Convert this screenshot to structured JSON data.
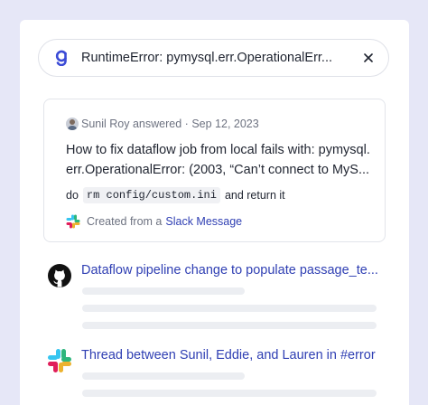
{
  "search": {
    "query": "RuntimeError: pymysql.err.OperationalErr...",
    "logo_icon": "g-logo-icon",
    "close_icon": "close-icon"
  },
  "answer_card": {
    "author": "Sunil Roy",
    "action": "answered",
    "separator": "·",
    "date": "Sep 12, 2023",
    "question": "How to fix dataflow job from local fails with: pymysql. err.OperationalError: (2003, “Can’t connect to MyS...",
    "answer_prefix": "do",
    "answer_code": "rm config/custom.ini",
    "answer_suffix": "and return it",
    "source_prefix": "Created from a",
    "source_link": "Slack Message"
  },
  "results": [
    {
      "icon": "github-icon",
      "title": "Dataflow pipeline change to populate passage_te..."
    },
    {
      "icon": "slack-icon",
      "title": "Thread between Sunil, Eddie, and Lauren in #error"
    }
  ],
  "colors": {
    "background": "#e6e7f7",
    "accent_link": "#2f3fb3",
    "logo": "#3b4bd6"
  }
}
